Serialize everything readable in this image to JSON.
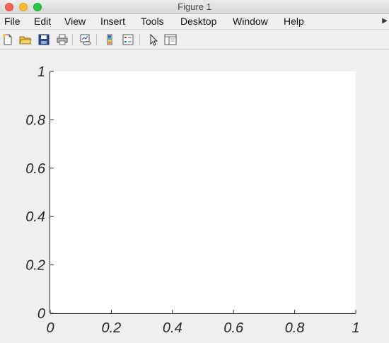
{
  "window": {
    "title": "Figure 1"
  },
  "menu": {
    "items": [
      "File",
      "Edit",
      "View",
      "Insert",
      "Tools",
      "Desktop",
      "Window",
      "Help"
    ],
    "overflow_icon": "chevron-right-icon"
  },
  "toolbar": {
    "buttons": [
      {
        "name": "new-figure-button",
        "icon": "new-document-icon"
      },
      {
        "name": "open-file-button",
        "icon": "folder-open-icon"
      },
      {
        "name": "save-button",
        "icon": "floppy-disk-icon"
      },
      {
        "name": "print-button",
        "icon": "printer-icon"
      },
      {
        "name": "link-plot-button",
        "icon": "link-plot-icon"
      },
      {
        "name": "insert-colorbar-button",
        "icon": "colorbar-icon"
      },
      {
        "name": "insert-legend-button",
        "icon": "legend-icon"
      },
      {
        "name": "edit-plot-button",
        "icon": "cursor-arrow-icon"
      },
      {
        "name": "plot-tools-button",
        "icon": "property-editor-icon"
      }
    ]
  },
  "colors": {
    "figure_background": "#efefef",
    "axes_background": "#ffffff",
    "axis_color": "#262626"
  },
  "chart_data": {
    "type": "line",
    "title": "",
    "xlabel": "",
    "ylabel": "",
    "series": [],
    "xlim": [
      0,
      1
    ],
    "ylim": [
      0,
      1
    ],
    "xticks": [
      "0",
      "0.2",
      "0.4",
      "0.6",
      "0.8",
      "1"
    ],
    "yticks": [
      "0",
      "0.2",
      "0.4",
      "0.6",
      "0.8",
      "1"
    ],
    "grid": false,
    "legend": "none"
  }
}
